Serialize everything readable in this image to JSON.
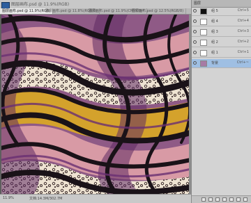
{
  "document": {
    "title": "图层画布.psd @ 11.9%(RGB)",
    "tabs": [
      "图层画布.psd @ 11.9%(RGB)",
      "图层画布.psd @ 11.8%(RGB/8)",
      "图层画布.psd @ 11.9%(CMYK/8)*",
      "图层画布.psd @ 12.5%(RGB/8)"
    ]
  },
  "status": {
    "zoom": "11.9%",
    "info": "文档:14.3M/302.7M"
  },
  "layers_panel": {
    "tab": "图层",
    "layers": [
      {
        "name": "组 5",
        "shortcut": "Ctrl+5",
        "dark": true,
        "active": false
      },
      {
        "name": "组 4",
        "shortcut": "Ctrl+4",
        "dark": false,
        "active": false
      },
      {
        "name": "组 3",
        "shortcut": "Ctrl+3",
        "dark": false,
        "active": false
      },
      {
        "name": "组 2",
        "shortcut": "Ctrl+2",
        "dark": false,
        "active": false
      },
      {
        "name": "组 1",
        "shortcut": "Ctrl+1",
        "dark": false,
        "active": false
      },
      {
        "name": "背景",
        "shortcut": "Ctrl+~",
        "dark": false,
        "active": true
      }
    ]
  },
  "colors": {
    "gold": "#d4a22c",
    "purple": "#5f2a63",
    "pink": "#d89aa5",
    "cream": "#eee3d2",
    "black": "#1a1218"
  }
}
